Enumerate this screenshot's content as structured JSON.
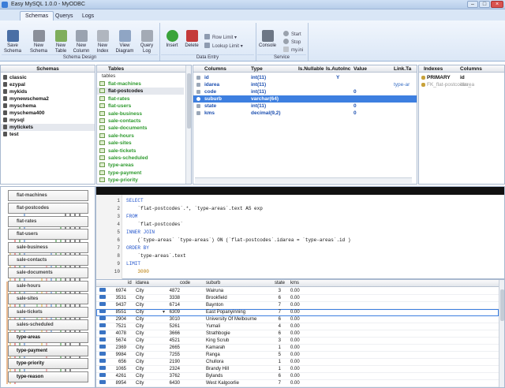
{
  "window": {
    "title": "Easy MySQL 1.0.0 - MyODBC"
  },
  "tabs": [
    {
      "label": "Schemas",
      "active": true
    },
    {
      "label": "Querys",
      "active": false
    },
    {
      "label": "Logs",
      "active": false
    }
  ],
  "ribbon": {
    "schema_design": {
      "group": "Schema Design",
      "buttons": [
        "Save Schema",
        "New Schema",
        "New Table",
        "New Column",
        "New Index",
        "View Diagram",
        "Query Log"
      ]
    },
    "data_entry": {
      "group": "Data Entry",
      "buttons": [
        "Insert",
        "Delete"
      ],
      "small": [
        "Row Limit",
        "Lookup Limit"
      ]
    },
    "service": {
      "group": "Service",
      "buttons": [
        "Console"
      ],
      "small": [
        "Start",
        "Stop",
        "my.ini"
      ]
    }
  },
  "schemas": {
    "header": "Schemas",
    "items": [
      "classic",
      "ezypal",
      "mykids",
      "mynewschema2",
      "myschema",
      "myschema400",
      "mysql",
      "mytickets",
      "test"
    ],
    "selected": "mytickets"
  },
  "tables": {
    "header": "Tables",
    "root": "tables",
    "items": [
      "flat-machines",
      "flat-postcodes",
      "flat-rates",
      "flat-users",
      "sale-business",
      "sale-contacts",
      "sale-documents",
      "sale-hours",
      "sale-sites",
      "sale-tickets",
      "sales-scheduled",
      "type-areas",
      "type-payment",
      "type-priority"
    ],
    "selected": "flat-postcodes"
  },
  "columns": {
    "headers": [
      "Columns",
      "Type",
      "Is.Nullable",
      "Is.AutoInc",
      "Value",
      "Link.Ta"
    ],
    "rows": [
      {
        "name": "id",
        "type": "int(11)",
        "nullable": "",
        "autoinc": "Y",
        "value": "",
        "link": ""
      },
      {
        "name": "idarea",
        "type": "int(11)",
        "nullable": "",
        "autoinc": "",
        "value": "",
        "link": "type-ar"
      },
      {
        "name": "code",
        "type": "int(11)",
        "nullable": "",
        "autoinc": "",
        "value": "0",
        "link": ""
      },
      {
        "name": "suburb",
        "type": "varchar(64)",
        "nullable": "",
        "autoinc": "",
        "value": "",
        "link": ""
      },
      {
        "name": "state",
        "type": "int(11)",
        "nullable": "",
        "autoinc": "",
        "value": "0",
        "link": ""
      },
      {
        "name": "kms",
        "type": "decimal(9,2)",
        "nullable": "",
        "autoinc": "",
        "value": "0",
        "link": ""
      }
    ],
    "selected": "suburb"
  },
  "indexes": {
    "headers": [
      "Indexes",
      "Columns"
    ],
    "rows": [
      {
        "name": "PRIMARY",
        "column": "id"
      },
      {
        "name": "FK_flat-postcodes_",
        "column": "idarea"
      }
    ]
  },
  "diagram": {
    "boxes": [
      "flat-machines",
      "flat-postcodes",
      "flat-rates",
      "flat-users",
      "sale-business",
      "sale-contacts",
      "sale-documents",
      "sale-hours",
      "sale-sites",
      "sale-tickets",
      "sales-scheduled",
      "type-areas",
      "type-payment",
      "type-priority",
      "type-reason"
    ]
  },
  "sql": {
    "lines": [
      {
        "n": "1",
        "t": "SELECT"
      },
      {
        "n": "2",
        "t": "    `flat-postcodes`.*, `type-areas`.text AS exp"
      },
      {
        "n": "3",
        "t": "FROM"
      },
      {
        "n": "4",
        "t": "    `flat-postcodes`"
      },
      {
        "n": "5",
        "t": "INNER JOIN"
      },
      {
        "n": "6",
        "t": "    (`type-areas` `type-areas`) ON (`flat-postcodes`.idarea = `type-areas`.id )"
      },
      {
        "n": "7",
        "t": "ORDER BY"
      },
      {
        "n": "8",
        "t": "    `type-areas`.text"
      },
      {
        "n": "9",
        "t": "LIMIT"
      },
      {
        "n": "10",
        "t": "    3000"
      }
    ]
  },
  "results": {
    "headers": [
      "id",
      "idarea",
      "code",
      "suburb",
      "state",
      "kms"
    ],
    "rows": [
      [
        "6974",
        "City",
        "4872",
        "Wairuna",
        "3",
        "0.00"
      ],
      [
        "3531",
        "City",
        "3338",
        "Brookfield",
        "6",
        "0.00"
      ],
      [
        "9437",
        "City",
        "6714",
        "Baynton",
        "7",
        "0.00"
      ],
      [
        "8551",
        "City",
        "6309",
        "East Popanyinning",
        "7",
        "0.00"
      ],
      [
        "2904",
        "City",
        "3010",
        "University Of Melbourne",
        "6",
        "0.00"
      ],
      [
        "7521",
        "City",
        "5261",
        "Yumali",
        "4",
        "0.00"
      ],
      [
        "4078",
        "City",
        "3666",
        "Strathbogie",
        "6",
        "0.00"
      ],
      [
        "5674",
        "City",
        "4521",
        "King Scrub",
        "3",
        "0.00"
      ],
      [
        "2369",
        "City",
        "2665",
        "Kamarah",
        "1",
        "0.00"
      ],
      [
        "9984",
        "City",
        "7255",
        "Ranga",
        "5",
        "0.00"
      ],
      [
        "656",
        "City",
        "2190",
        "Chullora",
        "1",
        "0.00"
      ],
      [
        "1065",
        "City",
        "2324",
        "Brandy Hill",
        "1",
        "0.00"
      ],
      [
        "4261",
        "City",
        "3762",
        "Bylands",
        "6",
        "0.00"
      ],
      [
        "8954",
        "City",
        "6430",
        "West Kalgoorlie",
        "7",
        "0.00"
      ]
    ],
    "selected_row": 3
  },
  "colors": {
    "selection": "#3d7fe0",
    "table_green": "#2e9a2e",
    "column_blue": "#1c4fb0"
  }
}
